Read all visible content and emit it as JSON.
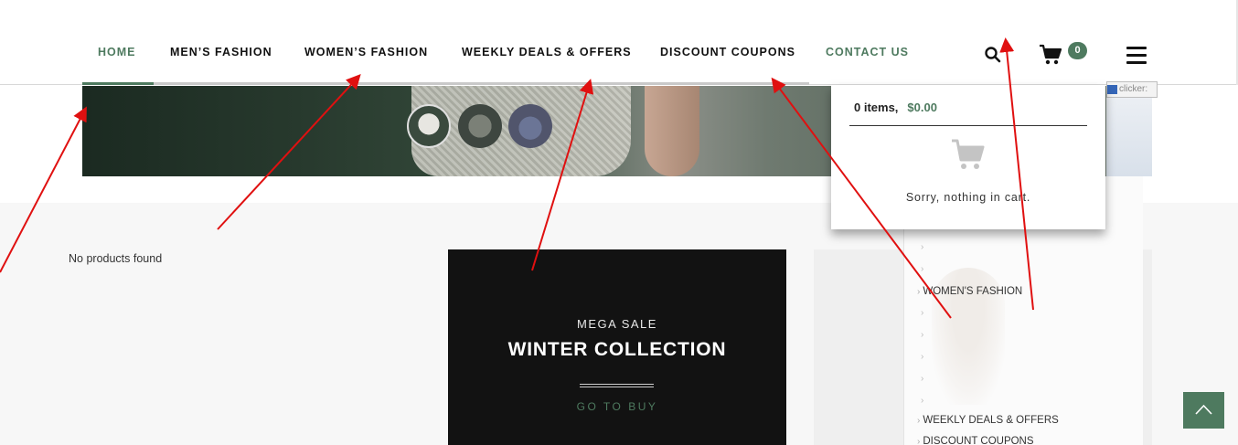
{
  "nav": {
    "items": [
      {
        "label": "HOME",
        "active": true
      },
      {
        "label": "MEN’S FASHION"
      },
      {
        "label": "WOMEN’S FASHION"
      },
      {
        "label": "WEEKLY DEALS & OFFERS"
      },
      {
        "label": "DISCOUNT COUPONS"
      },
      {
        "label": "CONTACT US"
      }
    ]
  },
  "header_icons": {
    "search": "search-icon",
    "cart": "cart-icon",
    "menu": "hamburger-menu-icon",
    "cart_count": "0"
  },
  "cart_dropdown": {
    "items_label": "0 items,",
    "total": "$0.00",
    "empty_message": "Sorry, nothing in cart."
  },
  "clicker_tag": "clicker:",
  "main": {
    "no_products": "No products found"
  },
  "promo": {
    "subtitle": "MEGA SALE",
    "title": "WINTER COLLECTION",
    "link": "GO TO BUY"
  },
  "side_menu": {
    "items": [
      "WOMEN'S FASHION",
      "WEEKLY DEALS & OFFERS",
      "DISCOUNT COUPONS"
    ]
  },
  "colors": {
    "accent": "#4e7a5f",
    "annotation_arrow": "#e01010",
    "promo_bg": "#121212"
  }
}
